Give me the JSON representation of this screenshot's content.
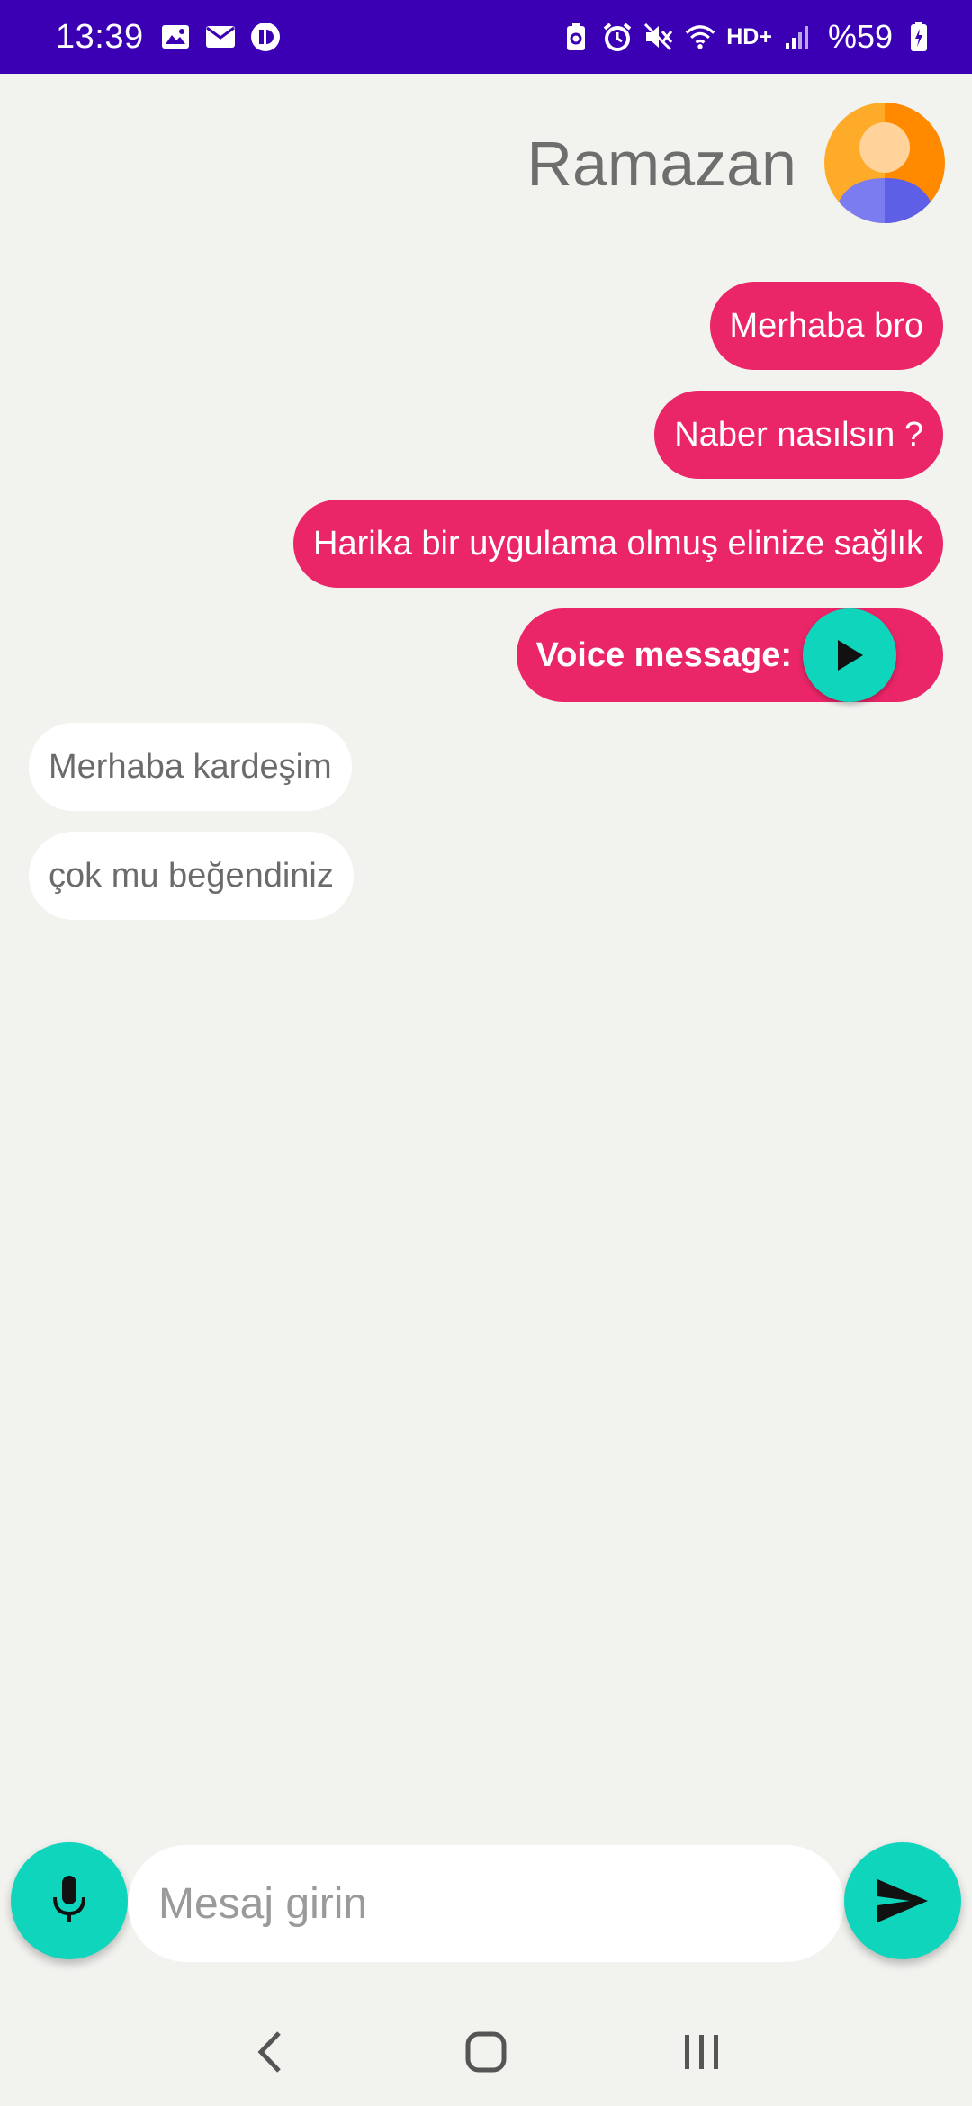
{
  "status_bar": {
    "time": "13:39",
    "network": "HD+",
    "battery": "%59",
    "left_icons": [
      "gallery-icon",
      "mail-icon",
      "app-notification-icon"
    ],
    "right_icons": [
      "battery-saver-icon",
      "alarm-icon",
      "mute-icon",
      "wifi-icon",
      "signal-icon",
      "battery-icon"
    ]
  },
  "chat": {
    "contact_name": "Ramazan",
    "messages": [
      {
        "direction": "sent",
        "text": "Merhaba bro"
      },
      {
        "direction": "sent",
        "text": "Naber nasılsın ?"
      },
      {
        "direction": "sent",
        "text": "Harika bir uygulama olmuş elinize sağlık"
      },
      {
        "direction": "sent",
        "text": "Voice message:",
        "type": "voice"
      },
      {
        "direction": "received",
        "text": "Merhaba kardeşim"
      },
      {
        "direction": "received",
        "text": "çok mu beğendiniz"
      }
    ]
  },
  "composer": {
    "placeholder": "Mesaj girin"
  },
  "colors": {
    "status_bar": "#3b00b3",
    "sent_bubble": "#ea2568",
    "received_bubble": "#ffffff",
    "accent": "#0fd5bd",
    "background": "#f2f2ef"
  }
}
